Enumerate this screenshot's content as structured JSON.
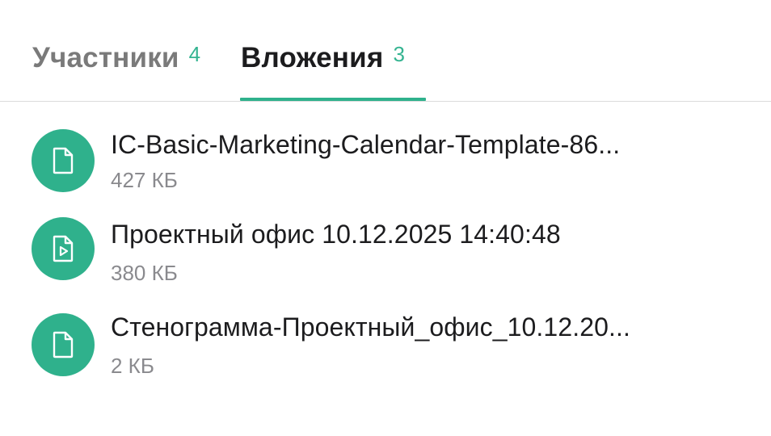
{
  "tabs": {
    "participants": {
      "label": "Участники",
      "count": "4"
    },
    "attachments": {
      "label": "Вложения",
      "count": "3"
    }
  },
  "accent_color": "#2fb18c",
  "files": [
    {
      "name": "IC-Basic-Marketing-Calendar-Template-86...",
      "size": "427 КБ",
      "icon": "document-icon"
    },
    {
      "name": "Проектный офис 10.12.2025 14:40:48",
      "size": "380 КБ",
      "icon": "video-file-icon"
    },
    {
      "name": "Стенограмма-Проектный_офис_10.12.20...",
      "size": "2 КБ",
      "icon": "document-icon"
    }
  ]
}
